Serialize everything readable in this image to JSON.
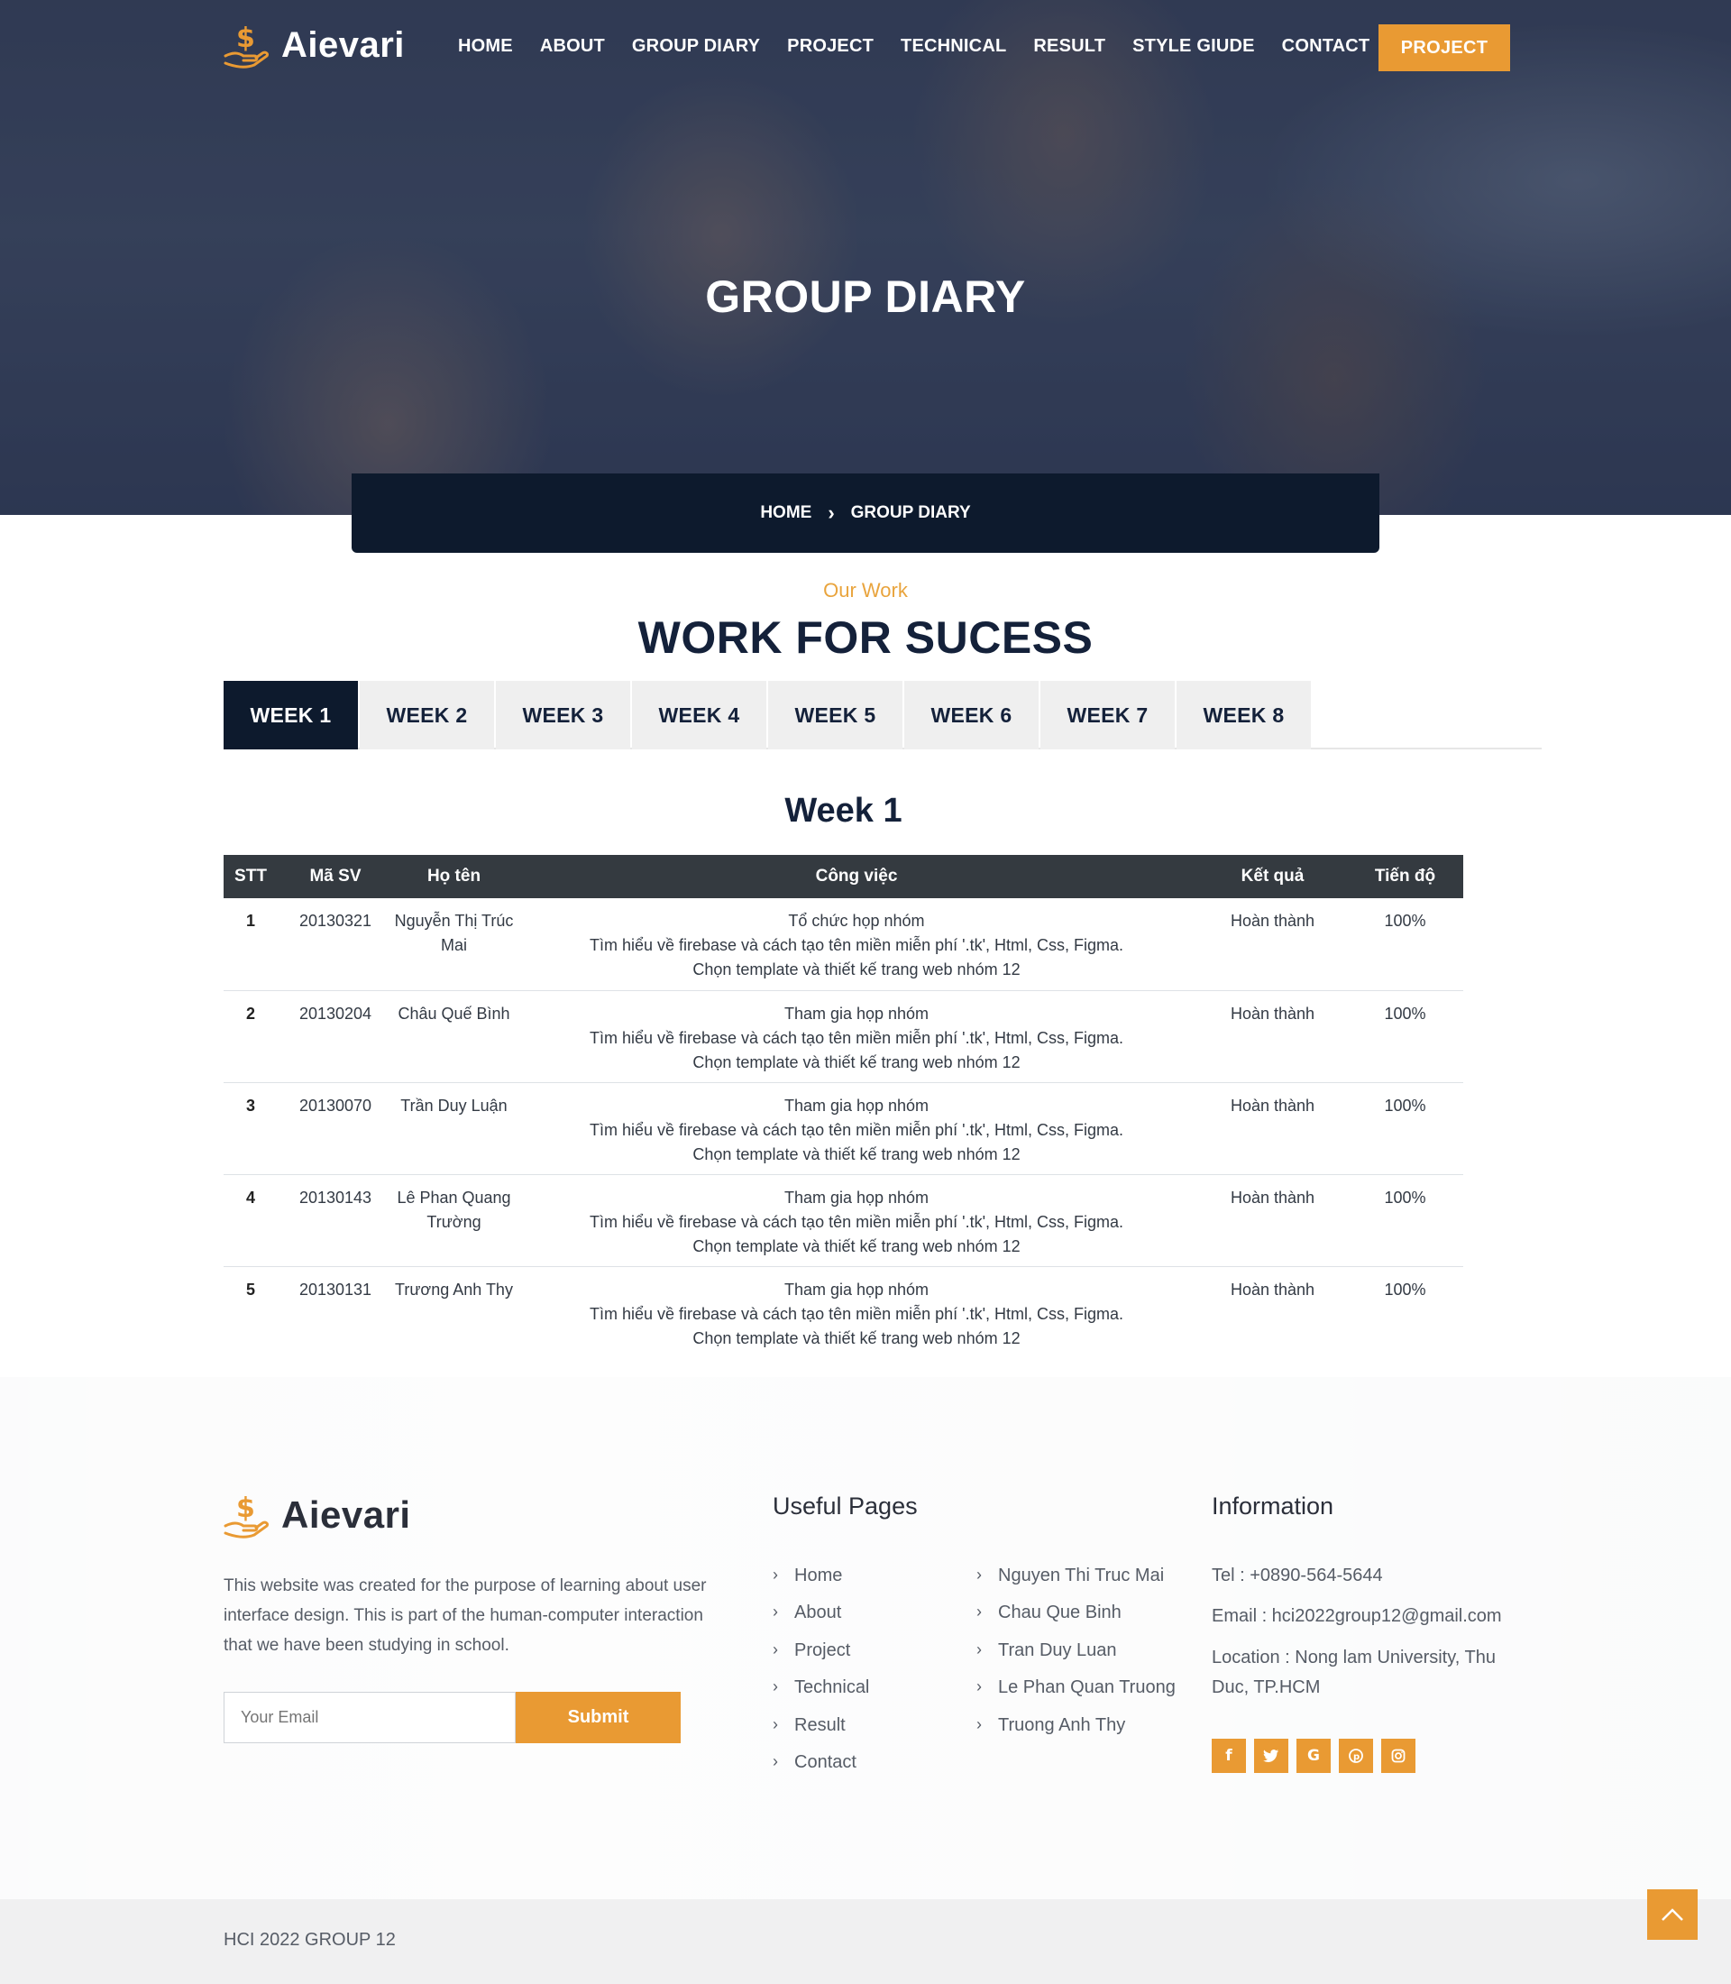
{
  "brand": {
    "name": "Aievari",
    "logo_icon": "dollar-hand-icon",
    "accent": "#e99a33",
    "dark": "#0d1a2d"
  },
  "nav": {
    "items": [
      "HOME",
      "ABOUT",
      "GROUP DIARY",
      "PROJECT",
      "TECHNICAL",
      "RESULT",
      "STYLE GIUDE",
      "CONTACT"
    ],
    "cta": "PROJECT"
  },
  "hero": {
    "title": "GROUP DIARY"
  },
  "breadcrumb": {
    "home": "HOME",
    "current": "GROUP DIARY",
    "sep_icon": "chevron-right-icon"
  },
  "section": {
    "kicker": "Our Work",
    "title": "WORK FOR SUCESS"
  },
  "tabs": [
    "WEEK 1",
    "WEEK 2",
    "WEEK 3",
    "WEEK 4",
    "WEEK 5",
    "WEEK 6",
    "WEEK 7",
    "WEEK 8"
  ],
  "active_tab": "WEEK 1",
  "week": {
    "title": "Week 1",
    "headers": [
      "STT",
      "Mã SV",
      "Họ tên",
      "Công việc",
      "Kết quả",
      "Tiến độ"
    ],
    "rows": [
      {
        "stt": "1",
        "id": "20130321",
        "name": "Nguyễn Thị Trúc Mai",
        "work1": "Tổ chức họp nhóm",
        "work2": "Tìm hiểu về firebase và cách tạo tên miền miễn phí '.tk', Html, Css, Figma.",
        "work3": "Chọn template và thiết kế trang web nhóm 12",
        "result": "Hoàn thành",
        "progress": "100%"
      },
      {
        "stt": "2",
        "id": "20130204",
        "name": "Châu Quế Bình",
        "work1": "Tham gia họp nhóm",
        "work2": "Tìm hiểu về firebase và cách tạo tên miền miễn phí '.tk', Html, Css, Figma.",
        "work3": "Chọn template và thiết kế trang web nhóm 12",
        "result": "Hoàn thành",
        "progress": "100%"
      },
      {
        "stt": "3",
        "id": "20130070",
        "name": "Trần Duy Luận",
        "work1": "Tham gia họp nhóm",
        "work2": "Tìm hiểu về firebase và cách tạo tên miền miễn phí '.tk', Html, Css, Figma.",
        "work3": "Chọn template và thiết kế trang web nhóm 12",
        "result": "Hoàn thành",
        "progress": "100%"
      },
      {
        "stt": "4",
        "id": "20130143",
        "name": "Lê Phan Quang Trường",
        "work1": "Tham gia họp nhóm",
        "work2": "Tìm hiểu về firebase và cách tạo tên miền miễn phí '.tk', Html, Css, Figma.",
        "work3": "Chọn template và thiết kế trang web nhóm 12",
        "result": "Hoàn thành",
        "progress": "100%"
      },
      {
        "stt": "5",
        "id": "20130131",
        "name": "Trương Anh Thy",
        "work1": "Tham gia họp nhóm",
        "work2": "Tìm hiểu về firebase và cách tạo tên miền miễn phí '.tk', Html, Css, Figma.",
        "work3": "Chọn template và thiết kế trang web nhóm 12",
        "result": "Hoàn thành",
        "progress": "100%"
      }
    ]
  },
  "footer": {
    "description": "This website was created for the purpose of learning about user interface design. This is part of the human-computer interaction that we have been studying in school.",
    "email_placeholder": "Your Email",
    "submit": "Submit",
    "useful_title": "Useful Pages",
    "useful_links": [
      "Home",
      "About",
      "Project",
      "Technical",
      "Result",
      "Contact"
    ],
    "member_links": [
      "Nguyen Thi Truc Mai",
      "Chau Que Binh",
      "Tran Duy Luan",
      "Le Phan Quan Truong",
      "Truong Anh Thy"
    ],
    "info_title": "Information",
    "tel": "Tel : +0890-564-5644",
    "email": "Email : hci2022group12@gmail.com",
    "location": "Location : Nong lam University, Thu Duc, TP.HCM",
    "socials": [
      "facebook-icon",
      "twitter-icon",
      "google-icon",
      "pinterest-icon",
      "instagram-icon"
    ]
  },
  "copyright": "HCI 2022 GROUP 12"
}
